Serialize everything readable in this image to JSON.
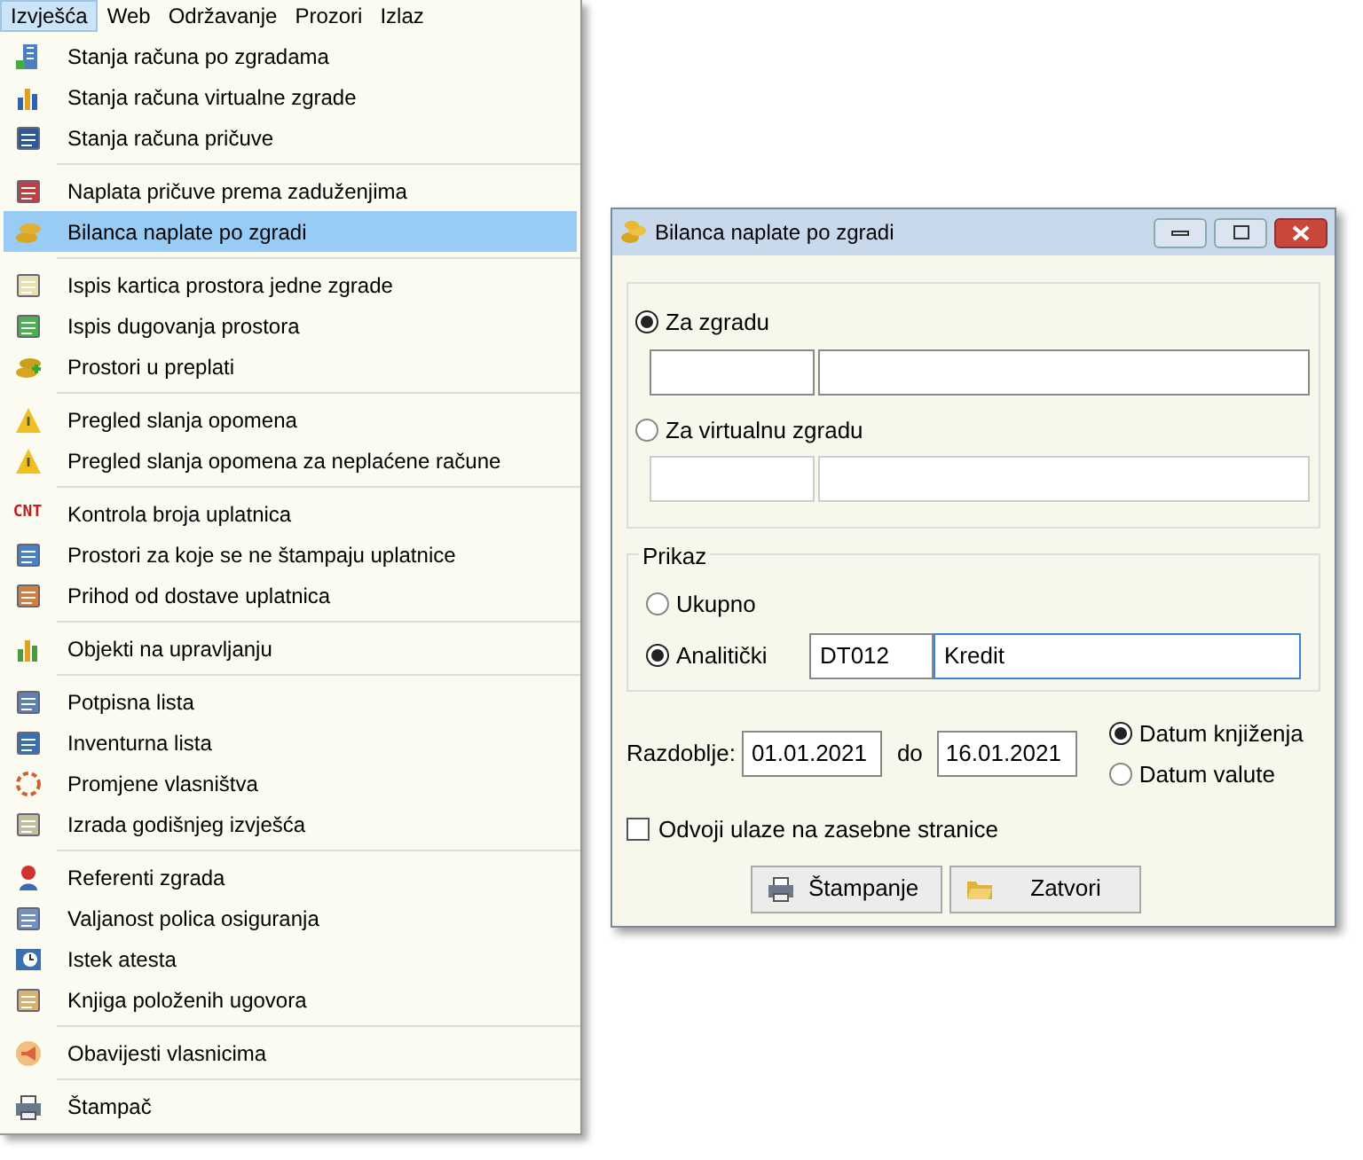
{
  "menu_bar": [
    {
      "label": "Izvješća",
      "selected": true
    },
    {
      "label": "Web",
      "selected": false
    },
    {
      "label": "Održavanje",
      "selected": false
    },
    {
      "label": "Prozori",
      "selected": false
    },
    {
      "label": "Izlaz",
      "selected": false
    }
  ],
  "menu_groups": [
    [
      {
        "label": "Stanja računa po zgradama",
        "selected": false
      },
      {
        "label": "Stanja računa virtualne zgrade",
        "selected": false
      },
      {
        "label": "Stanja računa pričuve",
        "selected": false
      }
    ],
    [
      {
        "label": "Naplata pričuve prema zaduženjima",
        "selected": false
      },
      {
        "label": "Bilanca naplate po zgradi",
        "selected": true
      }
    ],
    [
      {
        "label": "Ispis kartica prostora jedne zgrade",
        "selected": false
      },
      {
        "label": "Ispis dugovanja prostora",
        "selected": false
      },
      {
        "label": "Prostori u preplati",
        "selected": false
      }
    ],
    [
      {
        "label": "Pregled slanja opomena",
        "selected": false
      },
      {
        "label": "Pregled slanja opomena za neplaćene račune",
        "selected": false
      }
    ],
    [
      {
        "label": "Kontrola broja uplatnica",
        "selected": false,
        "icon_text": "CNT"
      },
      {
        "label": "Prostori za koje se ne štampaju uplatnice",
        "selected": false
      },
      {
        "label": "Prihod od dostave uplatnica",
        "selected": false
      }
    ],
    [
      {
        "label": "Objekti na upravljanju",
        "selected": false
      }
    ],
    [
      {
        "label": "Potpisna lista",
        "selected": false
      },
      {
        "label": "Inventurna lista",
        "selected": false
      },
      {
        "label": "Promjene vlasništva",
        "selected": false
      },
      {
        "label": "Izrada godišnjeg izvješća",
        "selected": false
      }
    ],
    [
      {
        "label": "Referenti zgrada",
        "selected": false
      },
      {
        "label": "Valjanost polica osiguranja",
        "selected": false
      },
      {
        "label": "Istek atesta",
        "selected": false
      },
      {
        "label": "Knjiga položenih ugovora",
        "selected": false
      }
    ],
    [
      {
        "label": "Obavijesti vlasnicima",
        "selected": false
      }
    ],
    [
      {
        "label": "Štampač",
        "selected": false
      }
    ]
  ],
  "dialog": {
    "title": "Bilanca naplate po zgradi",
    "building_options": [
      {
        "label": "Za zgradu",
        "selected": true
      },
      {
        "label": "Za virtualnu zgradu",
        "selected": false
      }
    ],
    "prikaz": {
      "legend": "Prikaz",
      "options": [
        {
          "label": "Ukupno",
          "selected": false
        },
        {
          "label": "Analitički",
          "selected": true
        }
      ],
      "code": "DT012",
      "name": "Kredit"
    },
    "period_label": "Razdoblje:",
    "date_from": "01.01.2021",
    "to_label": "do",
    "date_to": "16.01.2021",
    "date_types": [
      {
        "label": "Datum knjiženja",
        "selected": true
      },
      {
        "label": "Datum valute",
        "selected": false
      }
    ],
    "separate_pages": {
      "label": "Odvoji ulaze na zasebne stranice",
      "checked": false
    },
    "buttons": [
      {
        "label": "Štampanje",
        "kind": "print"
      },
      {
        "label": "Zatvori",
        "kind": "open"
      }
    ]
  }
}
